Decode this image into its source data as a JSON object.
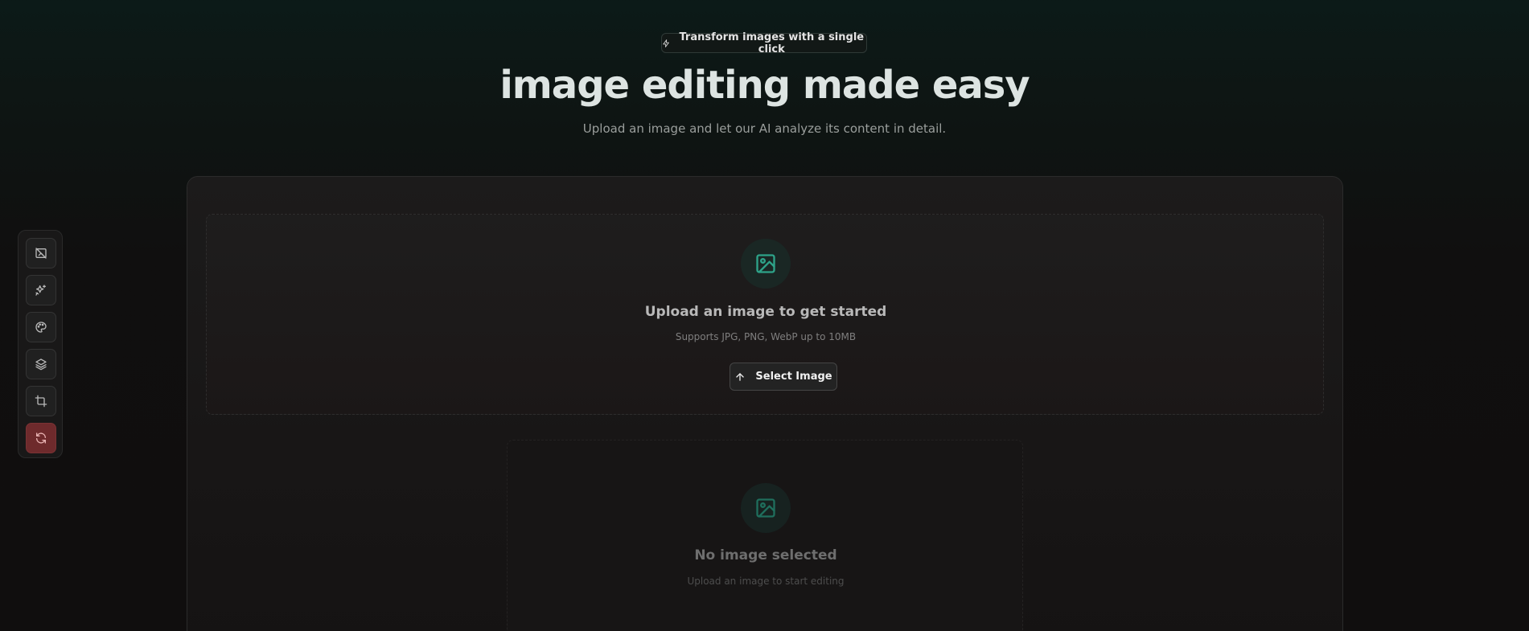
{
  "header": {
    "badge_text": "Transform images with a single click",
    "badge_icon": "zap-icon",
    "title": "image editing made easy",
    "subtitle": "Upload an image and let our AI analyze its content in detail."
  },
  "toolbar": {
    "tools": [
      {
        "name": "remove-background",
        "icon": "image-off-icon"
      },
      {
        "name": "enhance",
        "icon": "sparkles-icon"
      },
      {
        "name": "color",
        "icon": "palette-icon"
      },
      {
        "name": "layers",
        "icon": "layers-icon"
      },
      {
        "name": "crop",
        "icon": "crop-icon"
      },
      {
        "name": "reset",
        "icon": "refresh-icon"
      }
    ]
  },
  "upload": {
    "icon": "image-icon",
    "title": "Upload an image to get started",
    "subtitle": "Supports JPG, PNG, WebP up to 10MB",
    "button_label": "Select Image",
    "button_icon": "arrow-up-icon"
  },
  "preview": {
    "icon": "image-icon",
    "title": "No image selected",
    "subtitle": "Upload an image to start editing"
  },
  "colors": {
    "accent": "#2ea389",
    "reset_button": "#6e2a2c",
    "background": "#100e0e"
  }
}
